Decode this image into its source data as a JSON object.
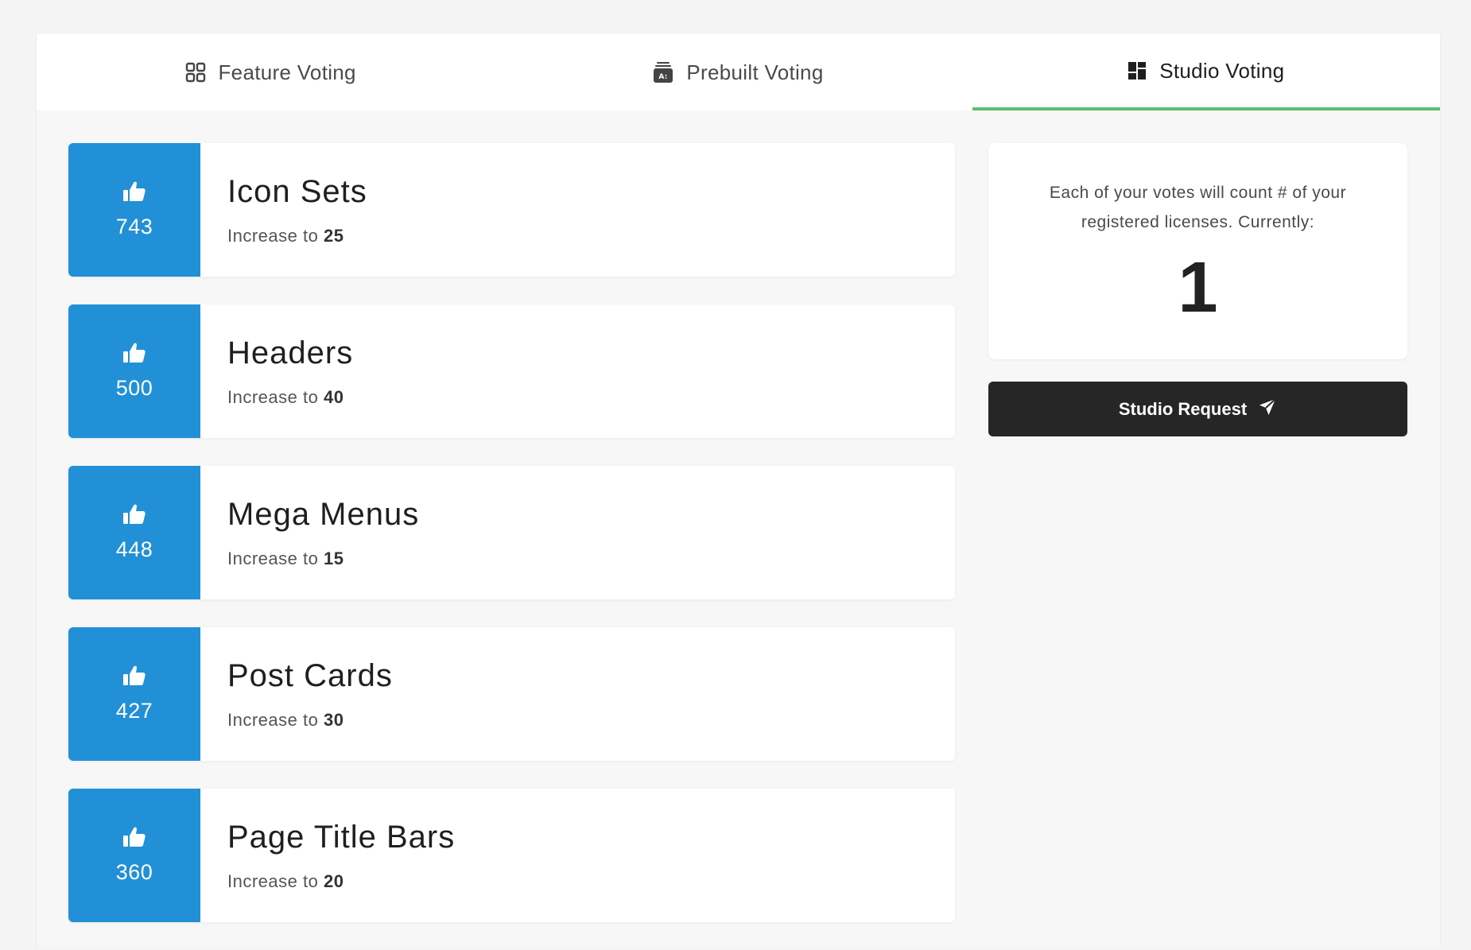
{
  "tabs": [
    {
      "label": "Feature Voting",
      "icon": "grid-icon",
      "active": false
    },
    {
      "label": "Prebuilt Voting",
      "icon": "template-icon",
      "active": false
    },
    {
      "label": "Studio Voting",
      "icon": "dashboard-icon",
      "active": true
    }
  ],
  "items": [
    {
      "votes": "743",
      "title": "Icon Sets",
      "increase_label": "Increase to",
      "increase_value": "25"
    },
    {
      "votes": "500",
      "title": "Headers",
      "increase_label": "Increase to",
      "increase_value": "40"
    },
    {
      "votes": "448",
      "title": "Mega Menus",
      "increase_label": "Increase to",
      "increase_value": "15"
    },
    {
      "votes": "427",
      "title": "Post Cards",
      "increase_label": "Increase to",
      "increase_value": "30"
    },
    {
      "votes": "360",
      "title": "Page Title Bars",
      "increase_label": "Increase to",
      "increase_value": "20"
    }
  ],
  "info": {
    "text": "Each of your votes will count # of your registered licenses. Currently:",
    "count": "1"
  },
  "studio_button": {
    "label": "Studio Request",
    "icon": "send-icon"
  },
  "colors": {
    "vote_blue": "#2290d6",
    "active_tab_underline": "#5bbd72",
    "button_dark": "#262626"
  }
}
